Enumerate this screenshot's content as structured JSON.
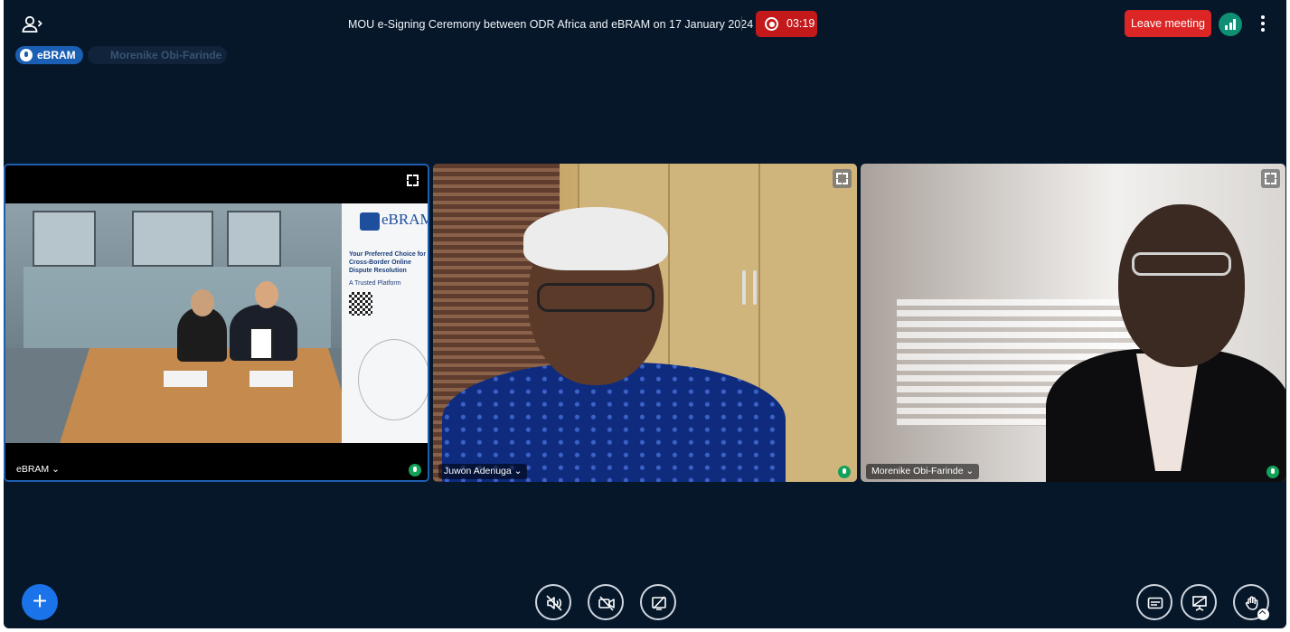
{
  "header": {
    "meeting_title": "MOU e-Signing Ceremony between ODR Africa and eBRAM on 17 January 2024",
    "recording_time": "03:19",
    "leave_label": "Leave meeting"
  },
  "talkers": [
    {
      "name": "eBRAM",
      "state": "talking"
    },
    {
      "name": "Morenike Obi-Farinde",
      "state": "idle"
    }
  ],
  "videos": [
    {
      "name": "eBRAM",
      "banner": {
        "brand": "eBRAM",
        "tagline": "Your Preferred Choice for Cross-Border Online Dispute Resolution",
        "subtag": "A Trusted Platform"
      }
    },
    {
      "name": "Juwon Adenuga"
    },
    {
      "name": "Morenike Obi-Farinde"
    }
  ],
  "toolbar": {
    "icons": [
      "plus-icon",
      "speaker-icon",
      "camera-icon",
      "screen-share-icon",
      "captions-icon",
      "presentation-icon",
      "hand-icon"
    ]
  },
  "colors": {
    "background": "#06172a",
    "accent": "#1a73e8",
    "recording": "#c3191b",
    "leave": "#dc2626",
    "active_tile_border": "#1e5eb0",
    "mic_on": "#14a15a",
    "connection": "#0f8f73"
  }
}
